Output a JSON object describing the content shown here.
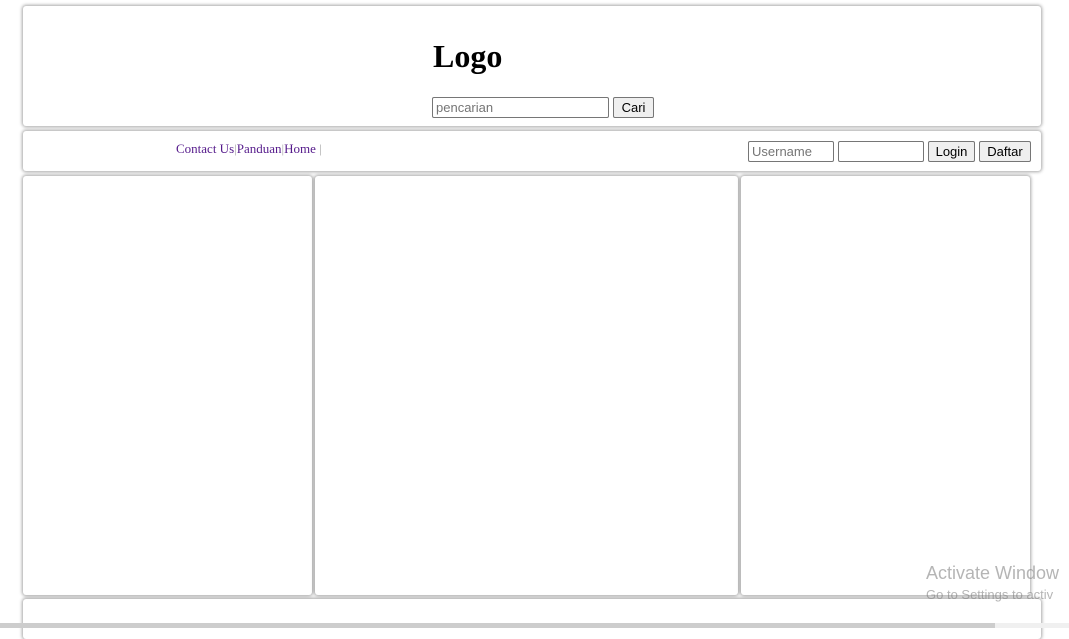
{
  "header": {
    "logo_text": "Logo",
    "search_placeholder": "pencarian",
    "search_button": "Cari"
  },
  "nav": {
    "links": [
      "Contact Us",
      "Panduan",
      "Home"
    ],
    "separator": "|",
    "username_placeholder": "Username",
    "login_button": "Login",
    "register_button": "Daftar"
  },
  "watermark": {
    "title": "Activate Window",
    "subtitle": "Go to Settings to activ"
  },
  "colors": {
    "link": "#551a8b",
    "button_bg": "#efefef"
  }
}
